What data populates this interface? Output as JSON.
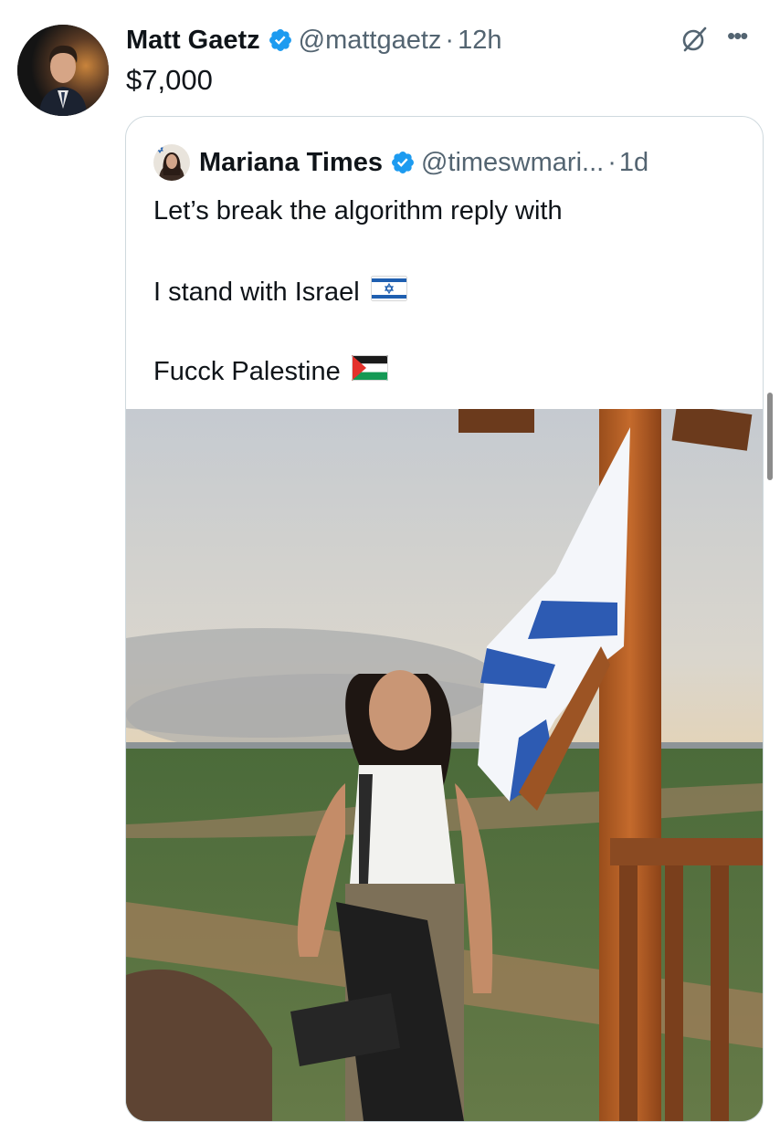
{
  "post": {
    "author_name": "Matt Gaetz",
    "handle": "@mattgaetz",
    "separator": "·",
    "time": "12h",
    "text": "$7,000",
    "verified_color": "#1d9bf0",
    "icons": [
      "avatar",
      "verified-badge-icon",
      "grok-icon",
      "more-options-icon"
    ]
  },
  "quoted_post": {
    "author_name": "Mariana Times",
    "handle": "@timeswmari...",
    "separator": "·",
    "time": "1d",
    "lines": [
      "Let’s break the algorithm reply with",
      "I stand with Israel",
      "Fucck Palestine"
    ],
    "flag_emojis": [
      "israel-flag-icon",
      "palestine-flag-icon"
    ],
    "media": "photo of a woman holding a rifle standing beside an Israeli flag on a wooden post, fields and cloudy sky behind"
  },
  "colors": {
    "text_primary": "#0f1419",
    "text_secondary": "#536471",
    "border": "#cfd9de",
    "verified_blue": "#1d9bf0"
  }
}
